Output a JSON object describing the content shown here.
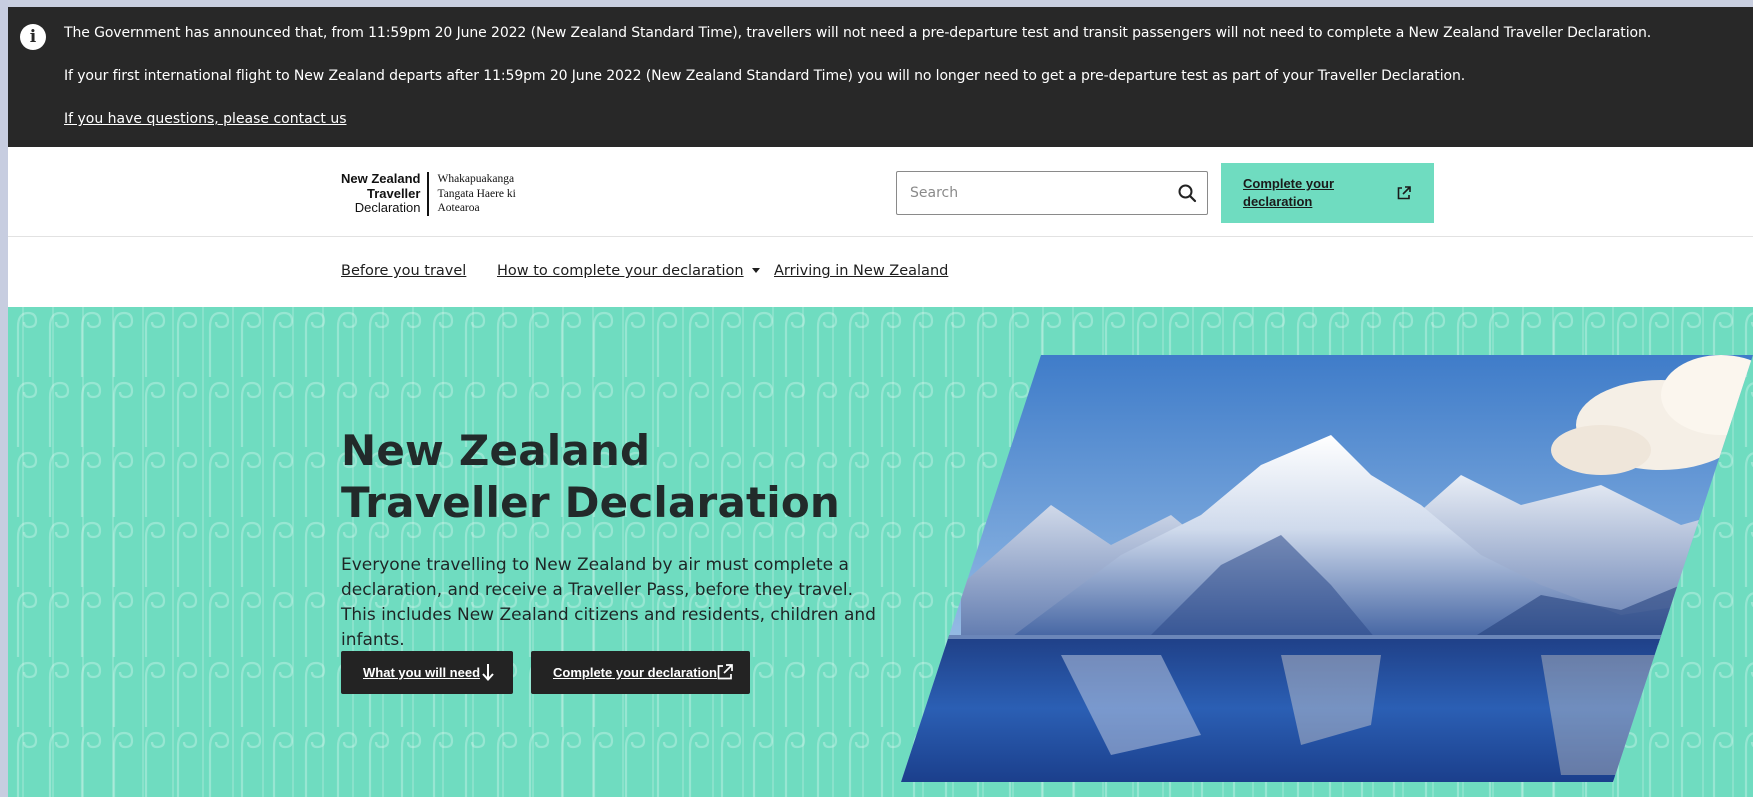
{
  "alert": {
    "icon": "info-icon",
    "line1": "The Government has announced that, from 11:59pm 20 June 2022 (New Zealand Standard Time), travellers will not need a pre-departure test and transit passengers will not need to complete a New Zealand Traveller Declaration.",
    "line2": "If your first international flight to New Zealand departs after 11:59pm 20 June 2022 (New Zealand Standard Time) you will no longer need to get a pre-departure test as part of your Traveller Declaration.",
    "link": "If you have questions, please contact us"
  },
  "header": {
    "logo": {
      "en_line1": "New Zealand",
      "en_line2": "Traveller",
      "en_line3": "Declaration",
      "mi_line1": "Whakapuakanga",
      "mi_line2": "Tangata Haere ki",
      "mi_line3": "Aotearoa"
    },
    "search": {
      "placeholder": "Search",
      "value": "",
      "icon": "search-icon"
    },
    "cta_label": "Complete your declaration",
    "cta_icon": "external-link-icon"
  },
  "nav": {
    "items": [
      {
        "label": "Before you travel"
      },
      {
        "label": "How to complete your declaration",
        "icon": "chevron-down-icon"
      },
      {
        "label": "Arriving in New Zealand"
      }
    ]
  },
  "hero": {
    "title": "New Zealand Traveller Declaration",
    "text": "Everyone travelling to New Zealand by air must complete a declaration, and receive a Traveller Pass, before they travel. This includes New Zealand citizens and residents, children and infants.",
    "buttons": [
      {
        "label": "What you will need",
        "icon": "arrow-down-icon"
      },
      {
        "label": "Complete your declaration",
        "icon": "external-link-icon"
      }
    ],
    "image": "mountain-lake-photo"
  },
  "colors": {
    "alert_bg": "#282828",
    "accent_teal": "#6fdcc0",
    "button_dark": "#232323",
    "text_dark": "#222a2a"
  }
}
